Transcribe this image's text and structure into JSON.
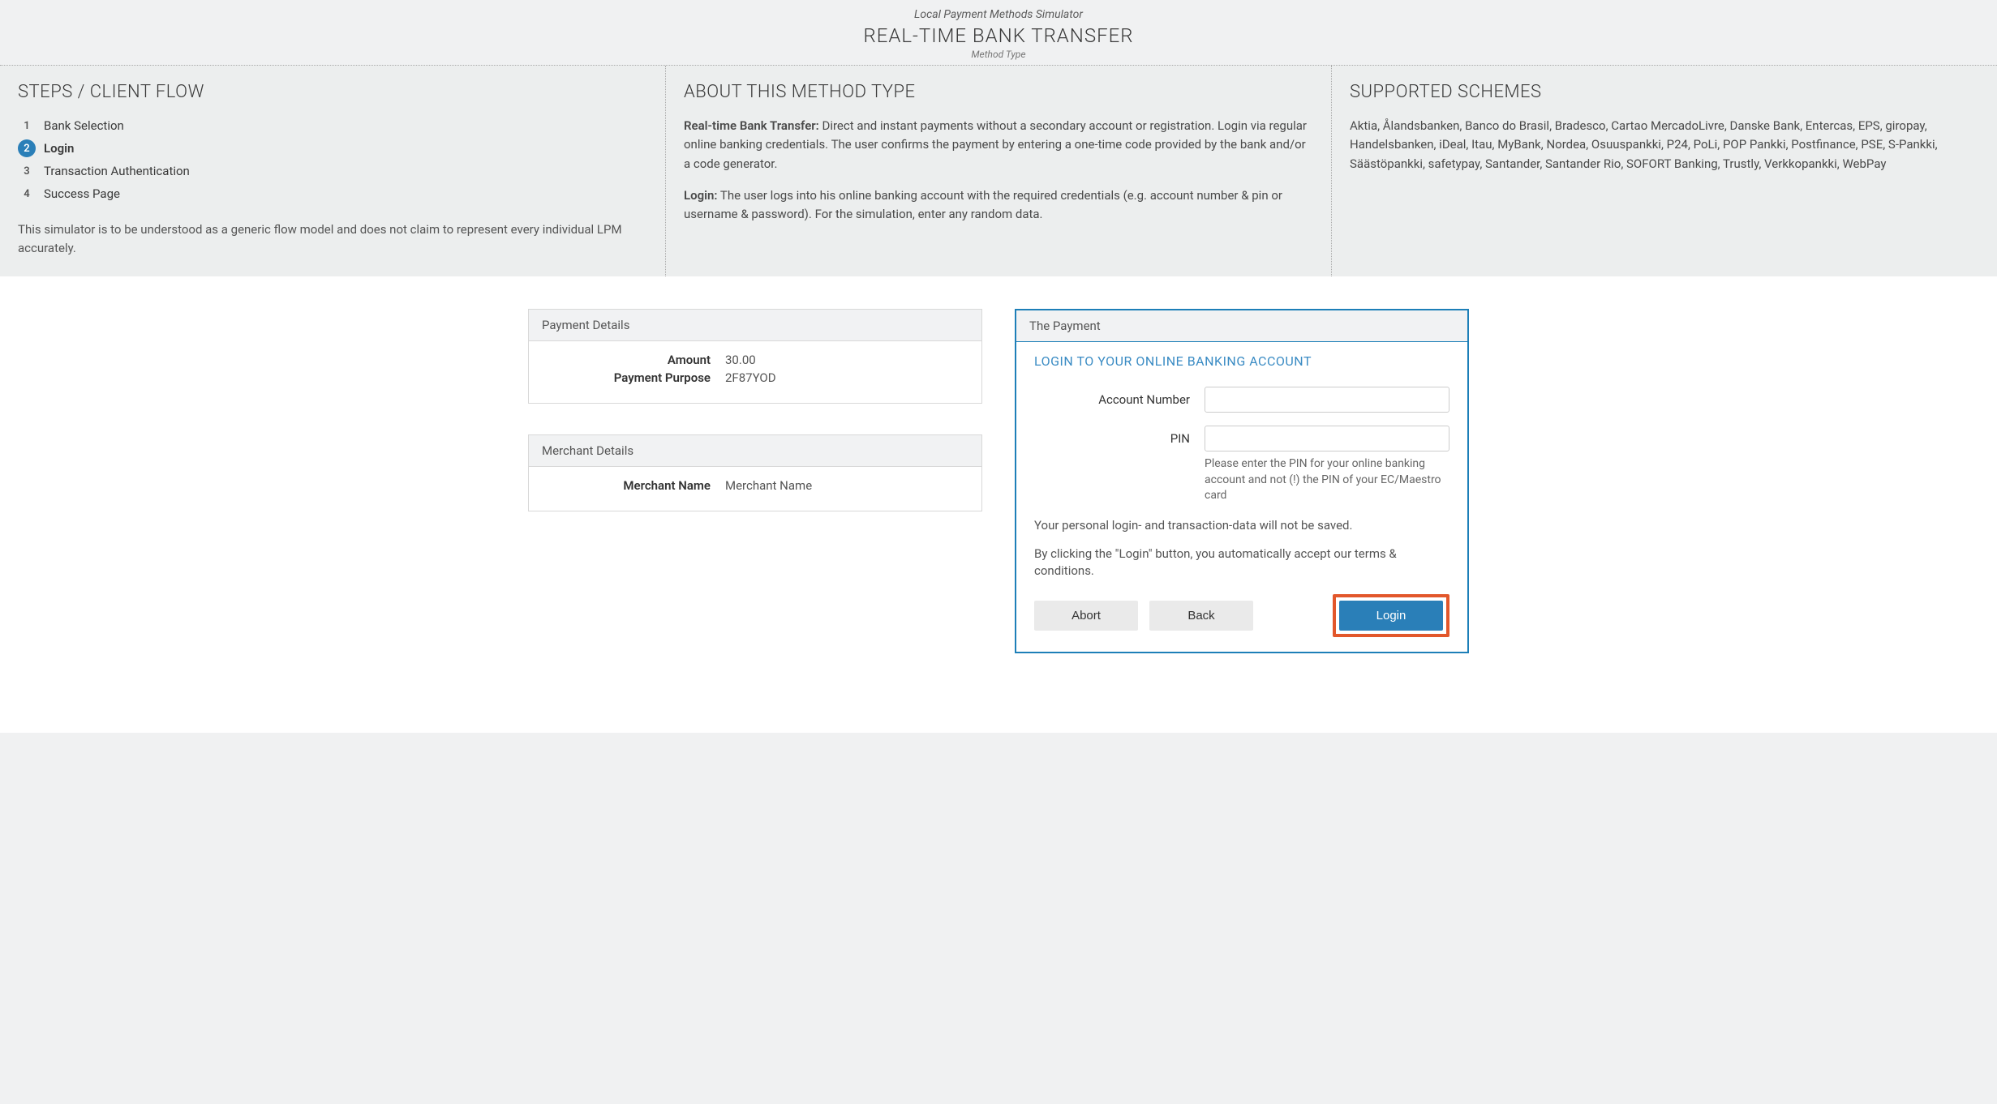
{
  "header": {
    "supertitle": "Local Payment Methods Simulator",
    "title": "REAL-TIME BANK TRANSFER",
    "subtitle": "Method Type"
  },
  "steps": {
    "heading": "STEPS / CLIENT FLOW",
    "items": [
      {
        "num": "1",
        "label": "Bank Selection"
      },
      {
        "num": "2",
        "label": "Login"
      },
      {
        "num": "3",
        "label": "Transaction Authentication"
      },
      {
        "num": "4",
        "label": "Success Page"
      }
    ],
    "active_index": 1,
    "disclaimer": "This simulator is to be understood as a generic flow model and does not claim to represent every individual LPM accurately."
  },
  "about": {
    "heading": "ABOUT THIS METHOD TYPE",
    "p1_label": "Real-time Bank Transfer:",
    "p1_text": " Direct and instant payments without a secondary account or registration. Login via regular online banking credentials. The user confirms the payment by entering a one-time code provided by the bank and/or a code generator.",
    "p2_label": "Login:",
    "p2_text": " The user logs into his online banking account with the required credentials (e.g. account number & pin or username & password). For the simulation, enter any random data."
  },
  "schemes": {
    "heading": "SUPPORTED SCHEMES",
    "text": "Aktia, Ålandsbanken, Banco do Brasil, Bradesco, Cartao MercadoLivre, Danske Bank, Entercas, EPS, giropay, Handelsbanken, iDeal, Itau, MyBank, Nordea, Osuuspankki, P24, PoLi, POP Pankki, Postfinance, PSE, S-Pankki, Säästöpankki, safetypay, Santander, Santander Rio, SOFORT Banking, Trustly, Verkkopankki, WebPay"
  },
  "payment_details": {
    "heading": "Payment Details",
    "amount_label": "Amount",
    "amount_value": "30.00",
    "purpose_label": "Payment Purpose",
    "purpose_value": "2F87YOD"
  },
  "merchant_details": {
    "heading": "Merchant Details",
    "name_label": "Merchant Name",
    "name_value": "Merchant Name"
  },
  "payment_form": {
    "card_heading": "The Payment",
    "section_title": "LOGIN TO YOUR ONLINE BANKING ACCOUNT",
    "account_label": "Account Number",
    "pin_label": "PIN",
    "pin_hint": "Please enter the PIN for your online banking account and not (!) the PIN of your EC/Maestro card",
    "note1": "Your personal login- and transaction-data will not be saved.",
    "note2": "By clicking the \"Login\" button, you automatically accept our terms & conditions.",
    "abort_label": "Abort",
    "back_label": "Back",
    "login_label": "Login"
  }
}
